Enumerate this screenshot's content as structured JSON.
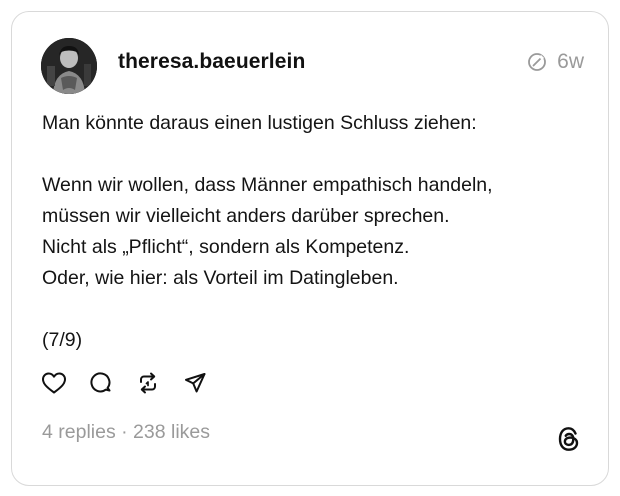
{
  "post": {
    "username": "theresa.baeuerlein",
    "time_ago": "6w",
    "lines": [
      "Man könnte daraus einen lustigen Schluss ziehen:",
      "",
      "Wenn wir wollen, dass Männer empathisch handeln,",
      "müssen wir vielleicht anders darüber sprechen.",
      "Nicht als „Pflicht“, sondern als Kompetenz.",
      "Oder, wie hier: als Vorteil im Datingleben.",
      "",
      "(7/9)"
    ],
    "stats": "4 replies · 238 likes"
  },
  "icons": {
    "avatar": "avatar",
    "edited": "edited-icon",
    "like": "heart-icon",
    "reply": "comment-icon",
    "repost": "repost-icon",
    "share": "share-icon",
    "logo": "threads-logo-icon"
  },
  "colors": {
    "text": "#141414",
    "muted": "#9a9a9a",
    "border": "#d9d9d9"
  }
}
